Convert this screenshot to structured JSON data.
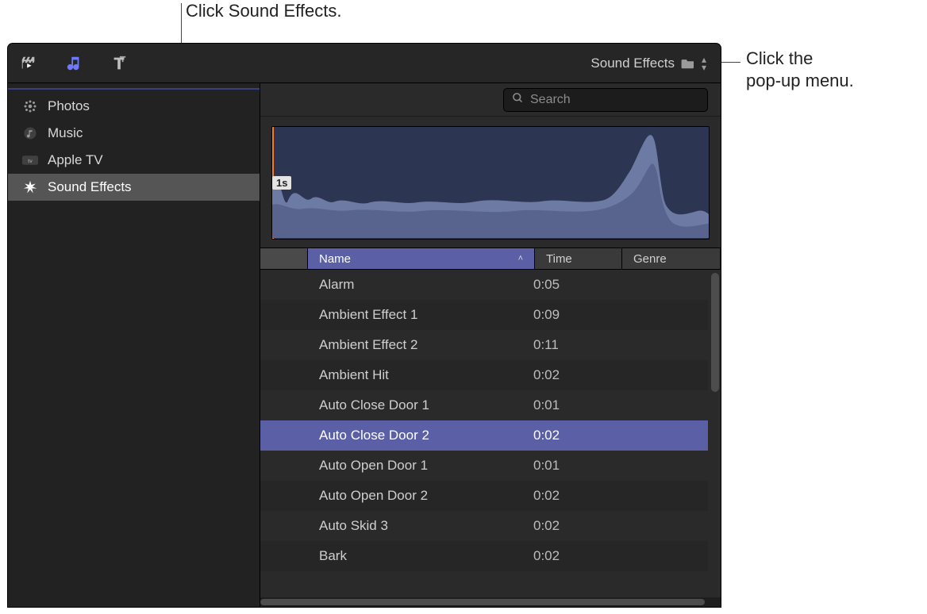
{
  "callouts": {
    "top": "Click Sound Effects.",
    "right_line1": "Click the",
    "right_line2": "pop-up menu."
  },
  "toolbar": {
    "popup_label": "Sound Effects"
  },
  "search": {
    "placeholder": "Search"
  },
  "sidebar": {
    "items": [
      {
        "label": "Photos",
        "icon": "photos"
      },
      {
        "label": "Music",
        "icon": "music"
      },
      {
        "label": "Apple TV",
        "icon": "appletv"
      },
      {
        "label": "Sound Effects",
        "icon": "burst",
        "selected": true
      }
    ]
  },
  "waveform": {
    "badge": "1s"
  },
  "columns": {
    "name": "Name",
    "time": "Time",
    "genre": "Genre"
  },
  "rows": [
    {
      "name": "Alarm",
      "time": "0:05"
    },
    {
      "name": "Ambient Effect 1",
      "time": "0:09"
    },
    {
      "name": "Ambient Effect 2",
      "time": "0:11"
    },
    {
      "name": "Ambient Hit",
      "time": "0:02"
    },
    {
      "name": "Auto Close Door 1",
      "time": "0:01"
    },
    {
      "name": "Auto Close Door 2",
      "time": "0:02",
      "selected": true
    },
    {
      "name": "Auto Open Door 1",
      "time": "0:01"
    },
    {
      "name": "Auto Open Door 2",
      "time": "0:02"
    },
    {
      "name": "Auto Skid 3",
      "time": "0:02"
    },
    {
      "name": "Bark",
      "time": "0:02"
    }
  ]
}
